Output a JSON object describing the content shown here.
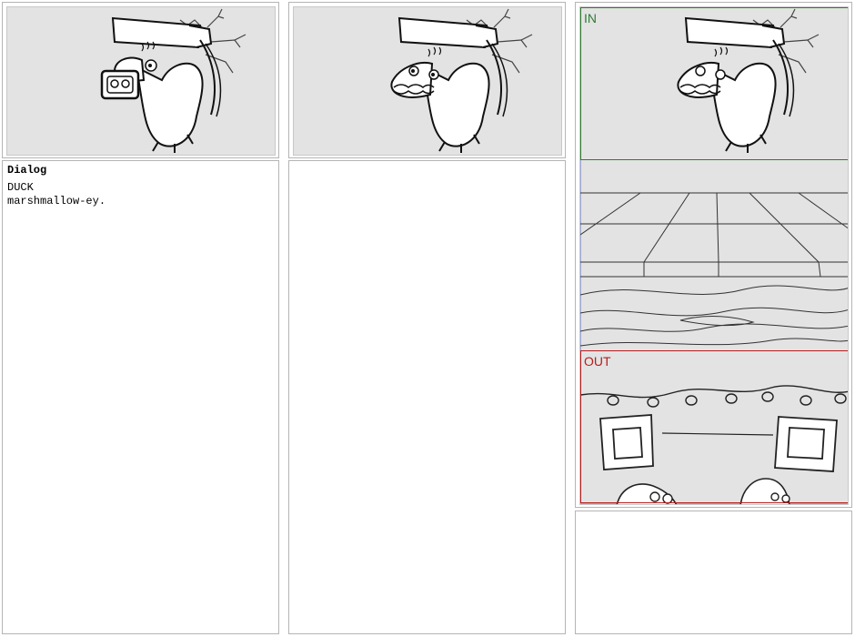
{
  "panels": [
    {
      "index": 1,
      "dialog": {
        "heading": "Dialog",
        "character": "DUCK",
        "line": "marshmallow-ey."
      }
    },
    {
      "index": 2
    },
    {
      "index": 3,
      "markers": {
        "in_label": "IN",
        "out_label": "OUT"
      }
    }
  ],
  "colors": {
    "frame_bg": "#e3e3e3",
    "in_marker": "#2e7d32",
    "out_marker": "#b71c1c",
    "camera_path": "#9fa8da"
  },
  "icons": [
    "duck-character-sketch",
    "wall-crack-sketch",
    "floor-perspective-sketch",
    "string-lights-sketch",
    "picture-frame-sketch"
  ]
}
